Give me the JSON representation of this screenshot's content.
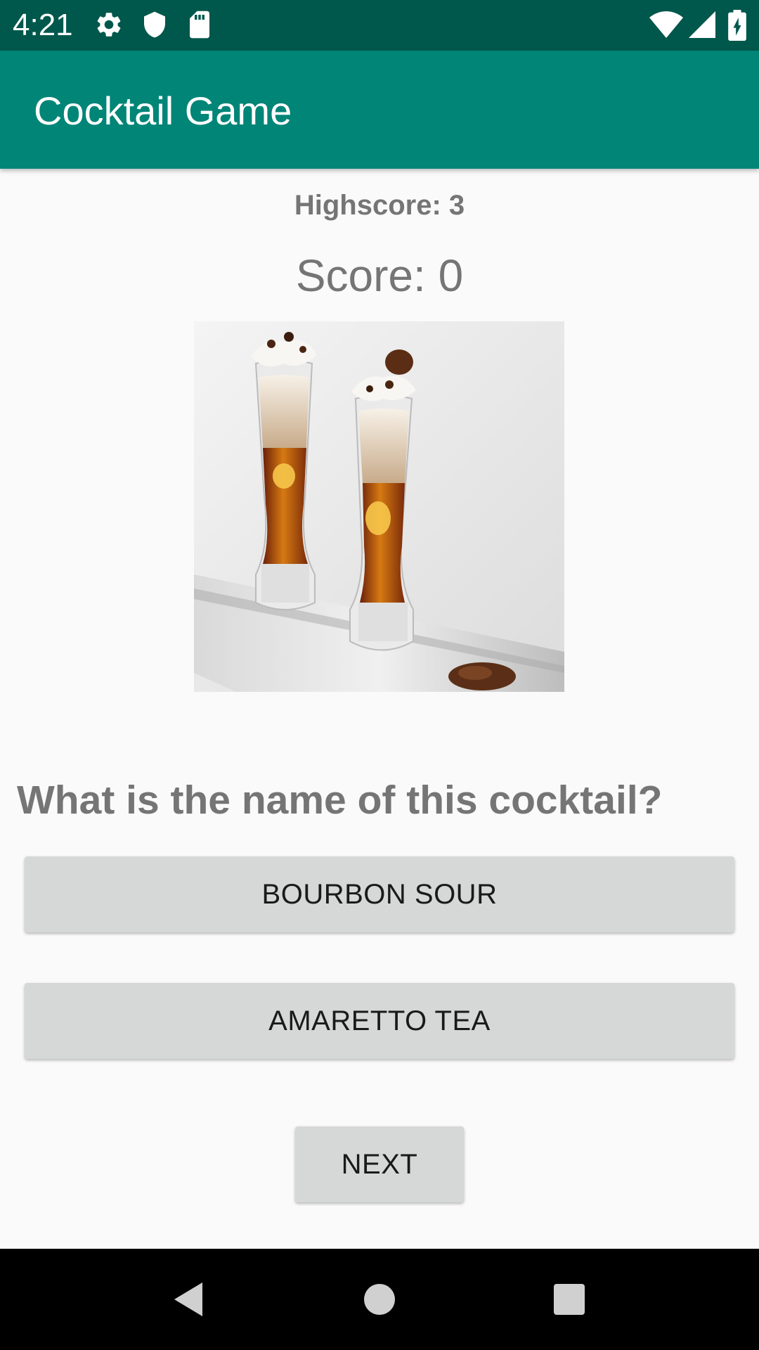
{
  "status_bar": {
    "time": "4:21",
    "left_icons": [
      "gear-icon",
      "shield-icon",
      "sd-card-icon"
    ],
    "right_icons": [
      "wifi-icon",
      "cell-signal-icon",
      "battery-icon"
    ]
  },
  "app_bar": {
    "title": "Cocktail Game",
    "color": "#008577",
    "status_color": "#00574b"
  },
  "game": {
    "highscore": "Highscore: 3",
    "score": "Score: 0",
    "image": "cocktail-image",
    "question": "What is the name of this cocktail?",
    "options": [
      "BOURBON SOUR",
      "AMARETTO TEA"
    ],
    "next_label": "NEXT"
  },
  "nav_bar": {
    "buttons": [
      "back-icon",
      "home-icon",
      "recents-icon"
    ]
  }
}
